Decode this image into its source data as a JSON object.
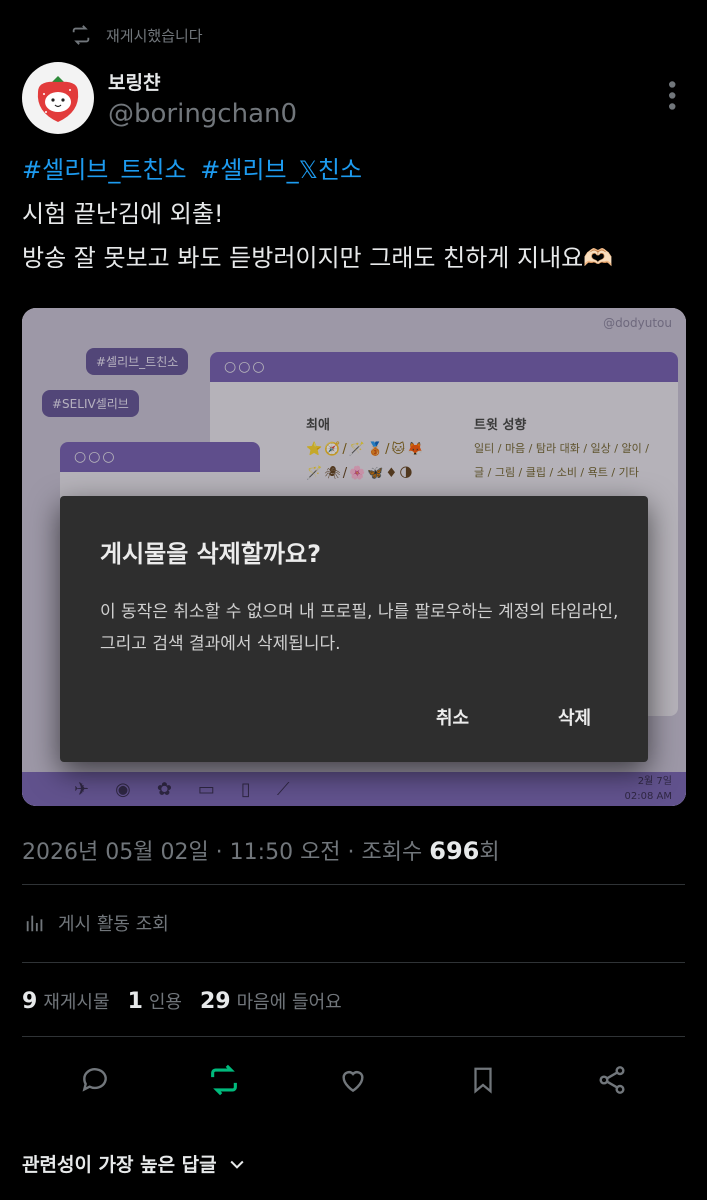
{
  "repost": {
    "label": "재게시했습니다"
  },
  "author": {
    "display_name": "보링챤",
    "handle": "@boringchan0"
  },
  "tweet": {
    "hashtags": [
      "#셀리브_트친소",
      "#셀리브_𝕏친소"
    ],
    "line1": "시험 끝난김에 외출!",
    "line2": "방송 잘 못보고 봐도 듣방러이지만 그래도 친하게 지내요🫶🏻"
  },
  "media": {
    "watermark": "@dodyutou",
    "chip1": "#셀리브_트친소",
    "chip2": "#SELIV셀리브",
    "window_dots": "○○○",
    "fav_label": "최애",
    "tweet_style_label": "트윗 성향",
    "tweet_style_line1": "일티 / 마음 / 탐라 대화 / 일상 / 알이 /",
    "tweet_style_line2": "글 / 그림 / 클립 / 소비 / 욕트 / 기타",
    "clock_date": "2월 7일",
    "clock_time": "02:08 AM"
  },
  "dialog": {
    "title": "게시물을 삭제할까요?",
    "body": "이 동작은 취소할 수 없으며 내 프로필, 나를 팔로우하는 계정의 타임라인, 그리고 검색 결과에서 삭제됩니다.",
    "cancel": "취소",
    "delete": "삭제"
  },
  "meta": {
    "date": "2026년 05월 02일",
    "time": "11:50 오전",
    "views_label": "조회수",
    "views": "696",
    "views_suffix": "회"
  },
  "activity": {
    "label": "게시 활동 조회"
  },
  "stats": {
    "reposts": "9",
    "reposts_label": "재게시물",
    "quotes": "1",
    "quotes_label": "인용",
    "likes": "29",
    "likes_label": "마음에 들어요"
  },
  "replies": {
    "label": "관련성이 가장 높은 답글"
  },
  "colors": {
    "accent": "#1d9bf0",
    "repost_active": "#00ba7c",
    "muted": "#71767b",
    "dialog_bg": "#2e2e2e"
  },
  "icons": [
    "repost-icon",
    "more-icon",
    "analytics-icon",
    "reply-icon",
    "like-icon",
    "bookmark-icon",
    "share-icon",
    "chevron-down-icon"
  ]
}
